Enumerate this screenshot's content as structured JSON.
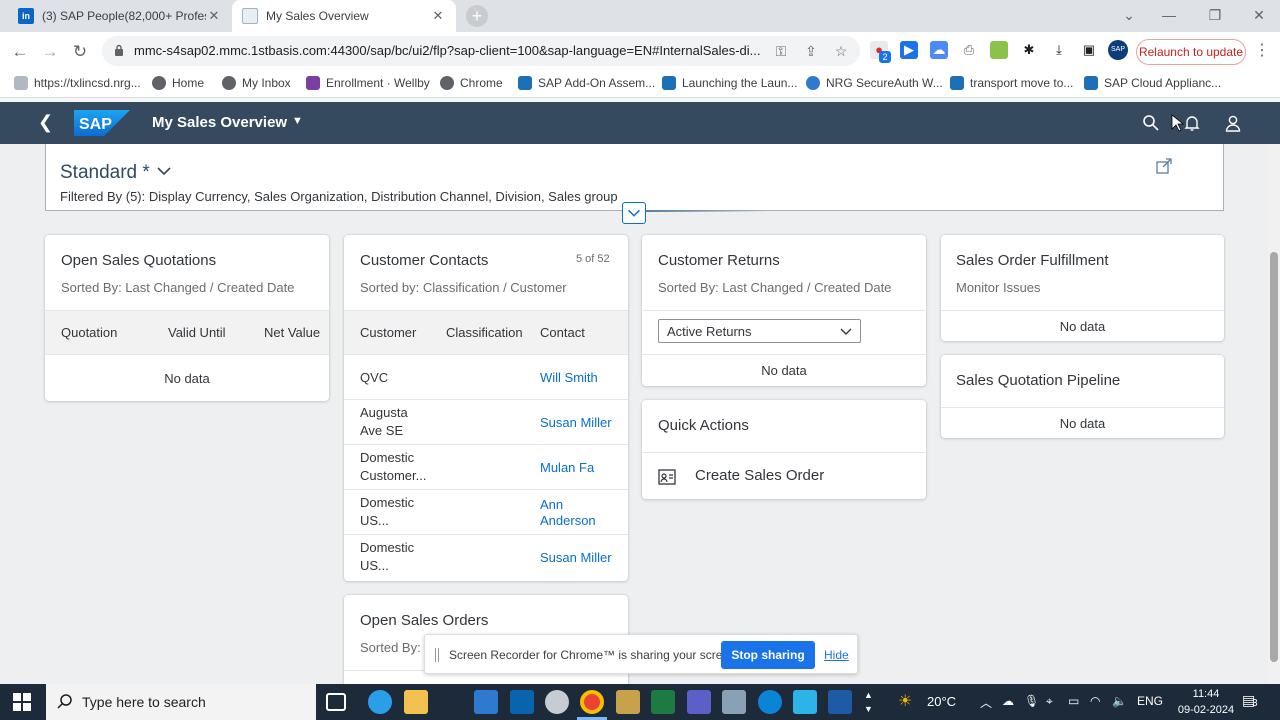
{
  "browser": {
    "tabs": [
      {
        "title": "(3) SAP People(82,000+ Profess",
        "favicon": "linkedin-icon"
      },
      {
        "title": "My Sales Overview",
        "favicon": "sap-page-icon"
      }
    ],
    "url": "mmc-s4sap02.mmc.1stbasis.com:44300/sap/bc/ui2/flp?sap-client=100&sap-language=EN#InternalSales-di...",
    "relaunch_label": "Relaunch to update",
    "extension_badge": "2",
    "bookmarks": [
      {
        "label": "https://txlincsd.nrg..."
      },
      {
        "label": "Home"
      },
      {
        "label": "My Inbox"
      },
      {
        "label": "Enrollment · Wellby"
      },
      {
        "label": "Chrome"
      },
      {
        "label": "SAP Add-On Assem..."
      },
      {
        "label": "Launching the Laun..."
      },
      {
        "label": "NRG SecureAuth W..."
      },
      {
        "label": "transport move to..."
      },
      {
        "label": "SAP Cloud Applianc..."
      }
    ]
  },
  "shell": {
    "logo_text": "SAP",
    "app_title": "My Sales Overview"
  },
  "filter": {
    "variant": "Standard *",
    "filtered_by": "Filtered By (5): Display Currency, Sales Organization, Distribution Channel, Division, Sales group"
  },
  "cards": {
    "open_quotations": {
      "title": "Open Sales Quotations",
      "subtitle": "Sorted By: Last Changed / Created Date",
      "columns": [
        "Quotation",
        "Valid Until",
        "Net Value"
      ],
      "empty": "No data"
    },
    "customer_contacts": {
      "title": "Customer Contacts",
      "counter": "5 of 52",
      "subtitle": "Sorted by: Classification / Customer",
      "columns": [
        "Customer",
        "Classification",
        "Contact"
      ],
      "rows": [
        {
          "customer": "QVC",
          "contact": "Will Smith"
        },
        {
          "customer": "Augusta\nAve SE",
          "contact": "Susan Miller"
        },
        {
          "customer": "Domestic\nCustomer...",
          "contact": "Mulan Fa"
        },
        {
          "customer": "Domestic\nUS...",
          "contact": "Ann\nAnderson"
        },
        {
          "customer": "Domestic\nUS...",
          "contact": "Susan Miller"
        }
      ]
    },
    "customer_returns": {
      "title": "Customer Returns",
      "subtitle": "Sorted By: Last Changed / Created Date",
      "dropdown": "Active Returns",
      "empty": "No data"
    },
    "quick_actions": {
      "title": "Quick Actions",
      "action": "Create Sales Order"
    },
    "fulfillment": {
      "title": "Sales Order Fulfillment",
      "subtitle": "Monitor Issues",
      "empty": "No data"
    },
    "quotation_pipeline": {
      "title": "Sales Quotation Pipeline",
      "empty": "No data"
    },
    "open_orders": {
      "title": "Open Sales Orders",
      "subtitle": "Sorted By:"
    }
  },
  "recorder": {
    "message": "Screen Recorder for Chrome™ is sharing your screen.",
    "stop_label": "Stop sharing",
    "hide_label": "Hide"
  },
  "taskbar": {
    "search_placeholder": "Type here to search",
    "weather": "20°C",
    "language": "ENG",
    "time": "11:44",
    "date": "09-02-2024",
    "notifications": "3"
  }
}
